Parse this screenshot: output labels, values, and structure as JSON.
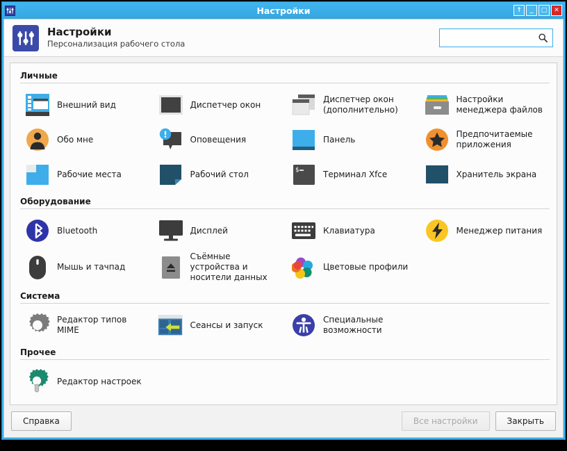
{
  "window": {
    "title": "Настройки",
    "icon": "settings-sliders-icon",
    "controls": [
      {
        "name": "shade-button",
        "glyph": "↑"
      },
      {
        "name": "minimize-button",
        "glyph": "_"
      },
      {
        "name": "maximize-button",
        "glyph": "□"
      },
      {
        "name": "close-button",
        "glyph": "✕"
      }
    ]
  },
  "header": {
    "title": "Настройки",
    "subtitle": "Персонализация рабочего стола",
    "icon": "settings-sliders-icon"
  },
  "search": {
    "value": "",
    "placeholder": "",
    "icon": "search-icon"
  },
  "categories": [
    {
      "name": "personal",
      "title": "Личные",
      "items": [
        {
          "label": "Внешний вид",
          "icon": "appearance-icon"
        },
        {
          "label": "Диспетчер окон",
          "icon": "window-manager-icon"
        },
        {
          "label": "Диспетчер окон (дополнительно)",
          "icon": "window-manager-tweaks-icon"
        },
        {
          "label": "Настройки менеджера файлов",
          "icon": "file-manager-icon"
        },
        {
          "label": "Обо мне",
          "icon": "about-me-icon"
        },
        {
          "label": "Оповещения",
          "icon": "notifications-icon"
        },
        {
          "label": "Панель",
          "icon": "panel-icon"
        },
        {
          "label": "Предпочитаемые приложения",
          "icon": "preferred-applications-icon"
        },
        {
          "label": "Рабочие места",
          "icon": "workspaces-icon"
        },
        {
          "label": "Рабочий стол",
          "icon": "desktop-icon"
        },
        {
          "label": "Терминал Xfce",
          "icon": "terminal-icon"
        },
        {
          "label": "Хранитель экрана",
          "icon": "screensaver-icon"
        }
      ]
    },
    {
      "name": "hardware",
      "title": "Оборудование",
      "items": [
        {
          "label": "Bluetooth",
          "icon": "bluetooth-icon"
        },
        {
          "label": "Дисплей",
          "icon": "display-icon"
        },
        {
          "label": "Клавиатура",
          "icon": "keyboard-icon"
        },
        {
          "label": "Менеджер питания",
          "icon": "power-manager-icon"
        },
        {
          "label": "Мышь и тачпад",
          "icon": "mouse-touchpad-icon"
        },
        {
          "label": "Съёмные устройства и носители данных",
          "icon": "removable-media-icon"
        },
        {
          "label": "Цветовые профили",
          "icon": "color-profiles-icon"
        }
      ]
    },
    {
      "name": "system",
      "title": "Система",
      "items": [
        {
          "label": "Редактор типов MIME",
          "icon": "mime-type-editor-icon"
        },
        {
          "label": "Сеансы и запуск",
          "icon": "session-startup-icon"
        },
        {
          "label": "Специальные возможности",
          "icon": "accessibility-icon"
        }
      ]
    },
    {
      "name": "other",
      "title": "Прочее",
      "items": [
        {
          "label": "Редактор настроек",
          "icon": "settings-editor-icon"
        }
      ]
    }
  ],
  "buttons": {
    "help": "Справка",
    "all_settings": "Все настройки",
    "close": "Закрыть"
  },
  "colors": {
    "titlebar": "#3daee9",
    "accent": "#3daee9",
    "close_button": "#d62828",
    "app_icon": "#3b4aa8",
    "content_bg": "#fcfcfc"
  }
}
